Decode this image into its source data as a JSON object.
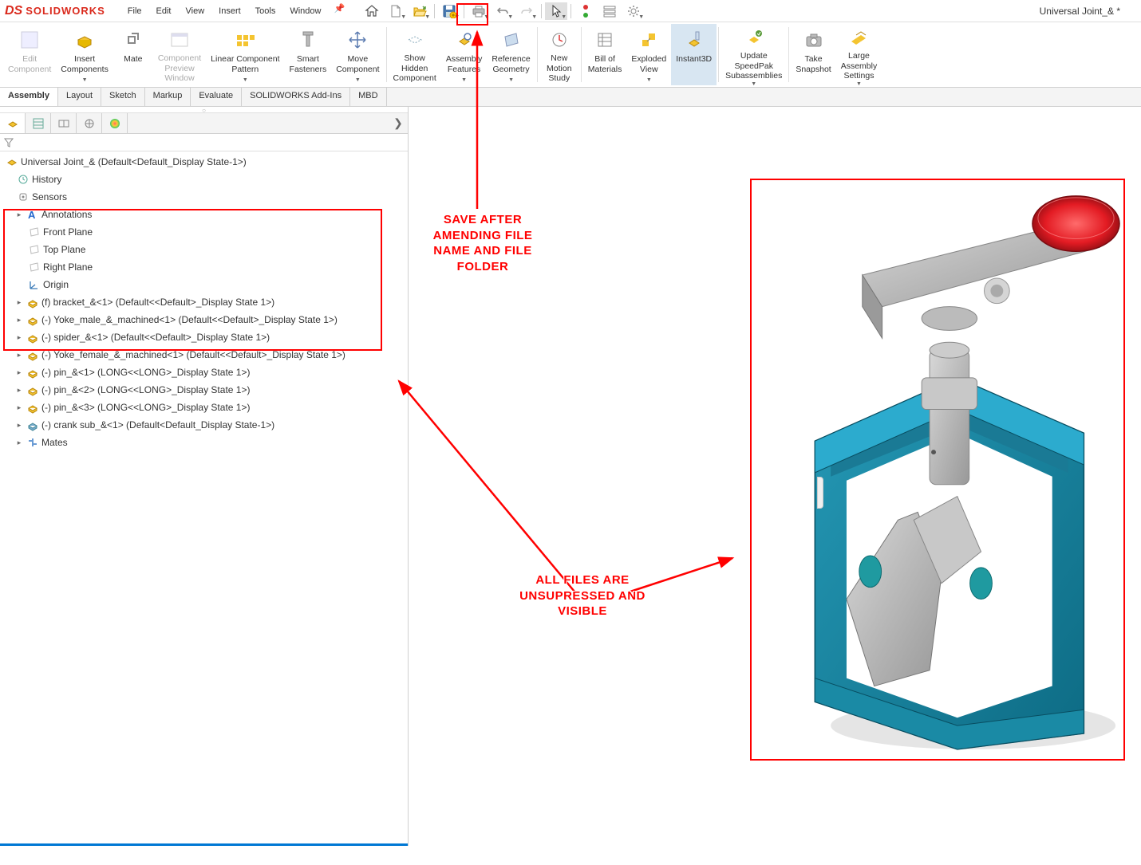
{
  "app": {
    "logo_prefix": "DS",
    "logo_text": "SOLIDWORKS"
  },
  "doc_title": "Universal Joint_& *",
  "menu": {
    "file": "File",
    "edit": "Edit",
    "view": "View",
    "insert": "Insert",
    "tools": "Tools",
    "window": "Window"
  },
  "ribbon": {
    "edit_component": "Edit\nComponent",
    "insert_components": "Insert\nComponents",
    "mate": "Mate",
    "component_preview": "Component\nPreview\nWindow",
    "linear_pattern": "Linear Component\nPattern",
    "smart_fasteners": "Smart\nFasteners",
    "move_component": "Move\nComponent",
    "show_hidden": "Show\nHidden\nComponent",
    "assembly_features": "Assembly\nFeatures",
    "reference_geometry": "Reference\nGeometry",
    "new_motion": "New\nMotion\nStudy",
    "bom": "Bill of\nMaterials",
    "exploded": "Exploded\nView",
    "instant3d": "Instant3D",
    "speedpak": "Update\nSpeedPak\nSubassemblies",
    "snapshot": "Take\nSnapshot",
    "large_asm": "Large\nAssembly\nSettings"
  },
  "tabs": {
    "assembly": "Assembly",
    "layout": "Layout",
    "sketch": "Sketch",
    "markup": "Markup",
    "evaluate": "Evaluate",
    "addins": "SOLIDWORKS Add-Ins",
    "mbd": "MBD"
  },
  "tree": {
    "root": "Universal Joint_&  (Default<Default_Display State-1>)",
    "history": "History",
    "sensors": "Sensors",
    "annotations": "Annotations",
    "front_plane": "Front Plane",
    "top_plane": "Top Plane",
    "right_plane": "Right Plane",
    "origin": "Origin",
    "comp1": "(f) bracket_&<1> (Default<<Default>_Display State 1>)",
    "comp2": "(-) Yoke_male_&_machined<1> (Default<<Default>_Display State 1>)",
    "comp3": "(-) spider_&<1> (Default<<Default>_Display State 1>)",
    "comp4": "(-) Yoke_female_&_machined<1> (Default<<Default>_Display State 1>)",
    "comp5": "(-) pin_&<1> (LONG<<LONG>_Display State 1>)",
    "comp6": "(-) pin_&<2> (LONG<<LONG>_Display State 1>)",
    "comp7": "(-) pin_&<3> (LONG<<LONG>_Display State 1>)",
    "comp8": "(-) crank sub_&<1> (Default<Default_Display State-1>)",
    "mates": "Mates"
  },
  "annotations": {
    "save": "SAVE AFTER\nAMENDING FILE\nNAME AND FILE\nFOLDER",
    "visible": "ALL FILES ARE\nUNSUPRESSED AND\nVISIBLE"
  }
}
